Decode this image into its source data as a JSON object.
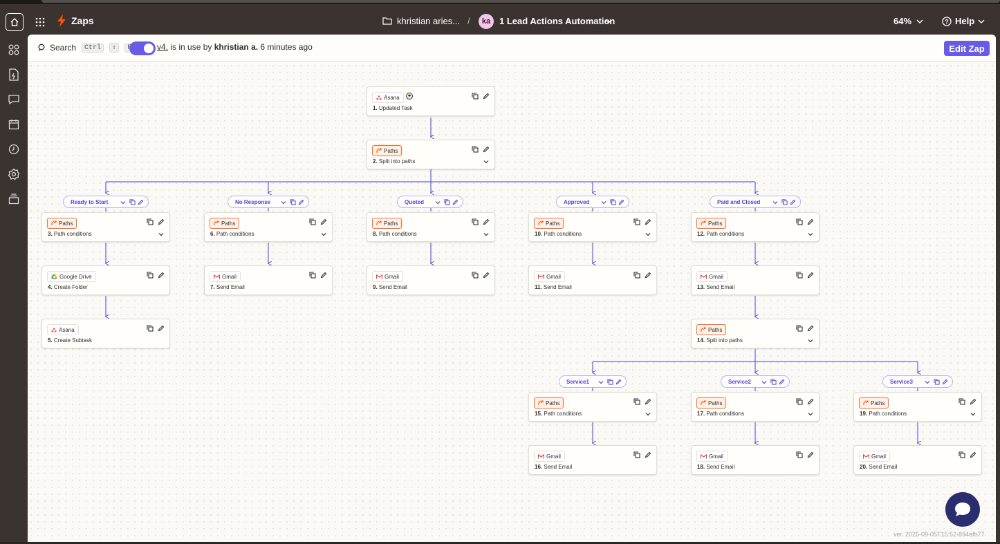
{
  "topbar": {
    "app_title": "Zaps",
    "folder_name": "khristian aries...",
    "separator": "/",
    "avatar_initials": "ka",
    "zap_name": "1 Lead Actions Automation",
    "zoom": "64%",
    "help": "Help"
  },
  "toolbar": {
    "search_label": "Search",
    "shortcut_ctrl": "Ctrl",
    "shortcut_shift": "⇧",
    "shortcut_key": "F",
    "version_link": "v4.",
    "status_mid": " is in use by ",
    "status_user": "khristian a.",
    "status_time": " 6 minutes ago",
    "edit_button": "Edit Zap"
  },
  "colors": {
    "accent": "#695be8",
    "paths_orange": "#ff6a2b",
    "wire": "#4b3fd0",
    "chrome": "#3b3330"
  },
  "cards": [
    {
      "app": "Asana",
      "icon": "asana-icon",
      "num": "1.",
      "title": "Updated Task",
      "trigger": true
    },
    {
      "app": "Paths",
      "icon": "paths-icon",
      "num": "2.",
      "title": "Split into paths",
      "chevron": true
    },
    {
      "app": "Paths",
      "icon": "paths-icon",
      "num": "3.",
      "title": "Path conditions",
      "chevron": true
    },
    {
      "app": "Google Drive",
      "icon": "google-drive-icon",
      "num": "4.",
      "title": "Create Folder"
    },
    {
      "app": "Asana",
      "icon": "asana-icon",
      "num": "5.",
      "title": "Create Subtask"
    },
    {
      "app": "Paths",
      "icon": "paths-icon",
      "num": "6.",
      "title": "Path conditions",
      "chevron": true
    },
    {
      "app": "Gmail",
      "icon": "gmail-icon",
      "num": "7.",
      "title": "Send Email"
    },
    {
      "app": "Paths",
      "icon": "paths-icon",
      "num": "8.",
      "title": "Path conditions",
      "chevron": true
    },
    {
      "app": "Gmail",
      "icon": "gmail-icon",
      "num": "9.",
      "title": "Send Email"
    },
    {
      "app": "Paths",
      "icon": "paths-icon",
      "num": "10.",
      "title": "Path conditions",
      "chevron": true
    },
    {
      "app": "Gmail",
      "icon": "gmail-icon",
      "num": "11.",
      "title": "Send Email"
    },
    {
      "app": "Paths",
      "icon": "paths-icon",
      "num": "12.",
      "title": "Path conditions",
      "chevron": true
    },
    {
      "app": "Gmail",
      "icon": "gmail-icon",
      "num": "13.",
      "title": "Send Email"
    },
    {
      "app": "Paths",
      "icon": "paths-icon",
      "num": "14.",
      "title": "Split into paths",
      "chevron": true
    },
    {
      "app": "Paths",
      "icon": "paths-icon",
      "num": "15.",
      "title": "Path conditions",
      "chevron": true
    },
    {
      "app": "Gmail",
      "icon": "gmail-icon",
      "num": "16.",
      "title": "Send Email"
    },
    {
      "app": "Paths",
      "icon": "paths-icon",
      "num": "17.",
      "title": "Path conditions",
      "chevron": true
    },
    {
      "app": "Gmail",
      "icon": "gmail-icon",
      "num": "18.",
      "title": "Send Email"
    },
    {
      "app": "Paths",
      "icon": "paths-icon",
      "num": "19.",
      "title": "Path conditions",
      "chevron": true
    },
    {
      "app": "Gmail",
      "icon": "gmail-icon",
      "num": "20.",
      "title": "Send Email"
    }
  ],
  "paths": [
    "Ready to Start",
    "No Response",
    "Quoted",
    "Approved",
    "Paid and Closed",
    "Service1",
    "Service2",
    "Service3"
  ],
  "version_text": "ver. 2025-09-05T15:52-894efb77"
}
